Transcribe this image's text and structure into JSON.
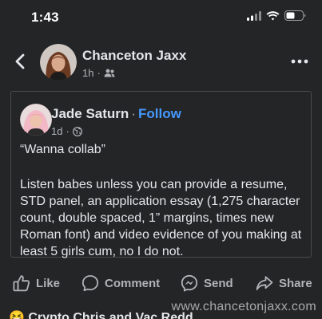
{
  "status_bar": {
    "time": "1:43"
  },
  "post": {
    "author": "Chanceton Jaxx",
    "time": "1h",
    "audience_icon": "friends-icon"
  },
  "shared_post": {
    "author": "Jade Saturn",
    "separator": "·",
    "follow_label": "Follow",
    "time": "1d",
    "audience_icon": "globe-icon",
    "quote": "“Wanna collab”",
    "body": "Listen babes unless you can provide a resume, STD panel, an application essay (1,275 character count, double spaced, 1” margins, times new Roman font) and video evidence of you making at least 5 girls cum, no I do not."
  },
  "actions": {
    "like": "Like",
    "comment": "Comment",
    "send": "Send",
    "share": "Share"
  },
  "next_post": {
    "emoji": "😆",
    "title": "Crypto Chris and Vac Redd"
  },
  "watermark": "www.chancetonjaxx.com",
  "colors": {
    "background": "#242526",
    "text": "#e4e6eb",
    "muted": "#b0b3b8",
    "link": "#4599ff",
    "card_border": "#4a4b4d"
  }
}
